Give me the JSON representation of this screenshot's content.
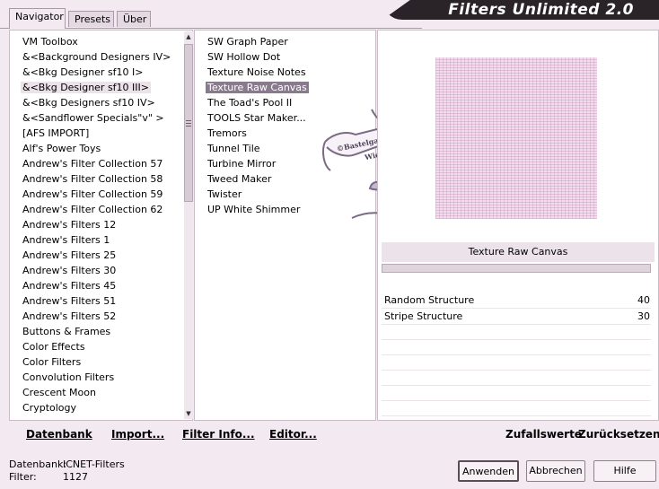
{
  "tabs": [
    "Navigator",
    "Presets",
    "Über"
  ],
  "title": "Filters Unlimited 2.0",
  "categories": [
    "VM Toolbox",
    "&<Background Designers IV>",
    "&<Bkg Designer sf10 I>",
    "&<Bkg Designer sf10 III>",
    "&<Bkg Designers sf10 IV>",
    "&<Sandflower Specials\"v\" >",
    "[AFS IMPORT]",
    "Alf's Power Toys",
    "Andrew's Filter Collection 57",
    "Andrew's Filter Collection 58",
    "Andrew's Filter Collection 59",
    "Andrew's Filter Collection 62",
    "Andrew's Filters 12",
    "Andrew's Filters 1",
    "Andrew's Filters 25",
    "Andrew's Filters 30",
    "Andrew's Filters 45",
    "Andrew's Filters 51",
    "Andrew's Filters 52",
    "Buttons & Frames",
    "Color Effects",
    "Color Filters",
    "Convolution Filters",
    "Crescent Moon",
    "Cryptology"
  ],
  "filters": [
    "SW Graph Paper",
    "SW Hollow Dot",
    "Texture Noise Notes",
    "Texture Raw Canvas",
    "The Toad's Pool II",
    "TOOLS Star Maker...",
    "Tremors",
    "Tunnel Tile",
    "Turbine Mirror",
    "Tweed Maker",
    "Twister",
    "UP White Shimmer"
  ],
  "selected_filter_name": "Texture Raw Canvas",
  "watermark": "©Bastelgarten Wien",
  "settings": [
    {
      "label": "Random Structure",
      "value": "40"
    },
    {
      "label": "Stripe Structure",
      "value": "30"
    }
  ],
  "links": {
    "datenbank": "Datenbank",
    "import": "Import...",
    "filterinfo": "Filter Info...",
    "editor": "Editor...",
    "zufallswerte": "Zufallswerte",
    "zuruecksetzen": "Zurücksetzen"
  },
  "status": {
    "db_label": "Datenbank:",
    "db_value": "ICNET-Filters",
    "filter_label": "Filter:",
    "filter_value": "1127"
  },
  "buttons": {
    "apply": "Anwenden",
    "cancel": "Abbrechen",
    "help": "Hilfe"
  },
  "icons": {
    "scroll_up": "up-arrow-icon",
    "scroll_down": "down-arrow-icon"
  }
}
